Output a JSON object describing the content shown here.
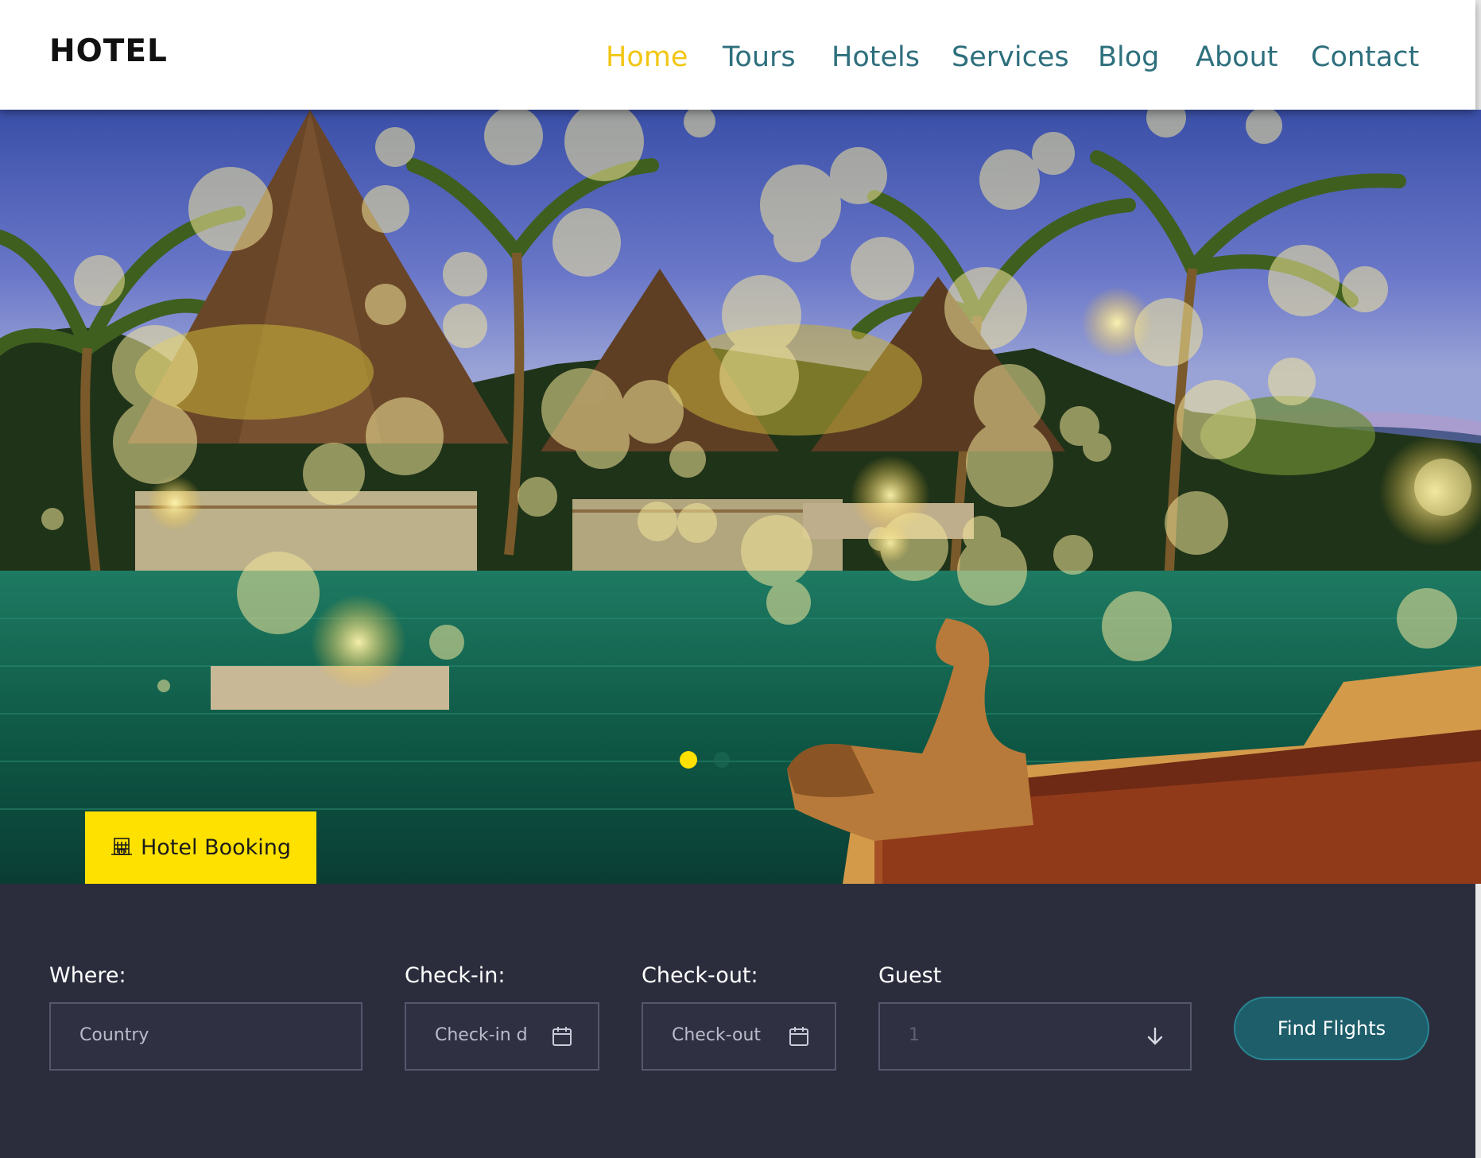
{
  "brand": "HOTEL",
  "nav": {
    "items": [
      "Home",
      "Tours",
      "Hotels",
      "Services",
      "Blog",
      "About",
      "Contact"
    ],
    "active": "Home"
  },
  "hero": {
    "description": "Tropical resort pool at dusk with thatched huts, palm trees and bokeh lights",
    "slider_dot_active": 1
  },
  "booking_tab": {
    "label": "Hotel Booking",
    "icon": "hotel-building-icon"
  },
  "form": {
    "where": {
      "label": "Where:",
      "placeholder": "Country"
    },
    "checkin": {
      "label": "Check-in:",
      "placeholder": "Check-in date",
      "icon": "calendar-icon"
    },
    "checkout": {
      "label": "Check-out:",
      "placeholder": "Check-out date",
      "icon": "calendar-icon"
    },
    "guest": {
      "label": "Guest",
      "value": "1",
      "icon": "arrow-down-icon"
    },
    "submit_label": "Find Flights"
  },
  "colors": {
    "accent": "#ffe100",
    "nav_link": "#2e6f7d",
    "nav_active": "#f2c614",
    "form_bg": "#2b2d3d",
    "button": "#1d5e6a"
  }
}
